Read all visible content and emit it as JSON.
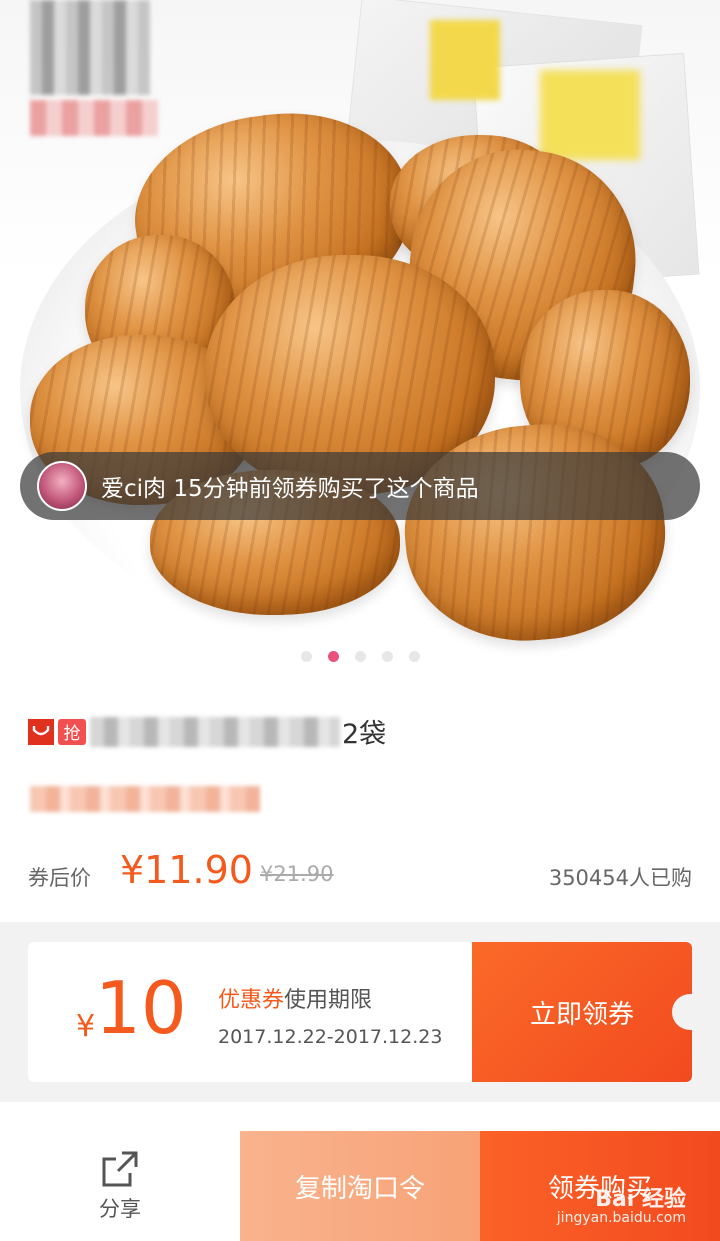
{
  "notification": {
    "text": "爱ci肉 15分钟前领券购买了这个商品"
  },
  "carousel": {
    "total": 5,
    "active_index": 1
  },
  "product": {
    "tmall_badge": "",
    "grab_badge": "抢",
    "title_visible_suffix": "2袋",
    "price_label": "券后价",
    "price": "¥11.90",
    "original_price": "¥21.90",
    "sold_count": "350454人已购"
  },
  "coupon": {
    "currency": "¥",
    "amount": "10",
    "title_highlight": "优惠券",
    "title_rest": "使用期限",
    "date_range": "2017.12.22-2017.12.23",
    "button_label": "立即领券"
  },
  "bottom_bar": {
    "share_label": "分享",
    "copy_label": "复制淘口令",
    "buy_label": "领券购买"
  },
  "watermark": {
    "brand": "Bai 经验",
    "url": "jingyan.baidu.com"
  },
  "colors": {
    "accent": "#f45a1d",
    "notification_bg": "#3c3c3c",
    "active_dot": "#e8527a",
    "copy_button": "#f9b38d",
    "buy_button": "#f24a1f"
  }
}
